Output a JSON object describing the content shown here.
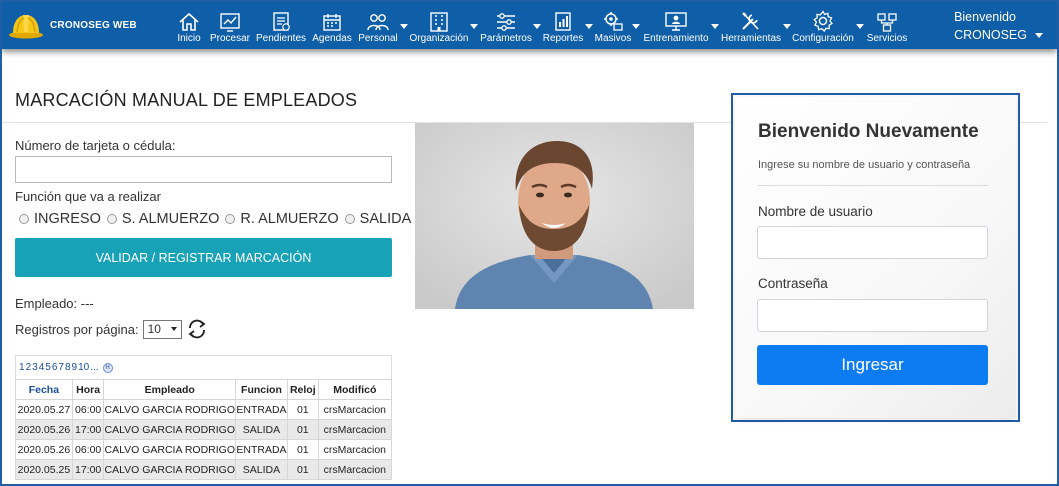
{
  "brand": {
    "name": "CRONOSEG WEB"
  },
  "nav": [
    {
      "label": "Inicio",
      "icon": "home-icon",
      "dropdown": false
    },
    {
      "label": "Procesar",
      "icon": "process-icon",
      "dropdown": false
    },
    {
      "label": "Pendientes",
      "icon": "pending-icon",
      "dropdown": false
    },
    {
      "label": "Agendas",
      "icon": "calendar-icon",
      "dropdown": false
    },
    {
      "label": "Personal",
      "icon": "people-icon",
      "dropdown": true
    },
    {
      "label": "Organización",
      "icon": "building-icon",
      "dropdown": true
    },
    {
      "label": "Parámetros",
      "icon": "sliders-icon",
      "dropdown": true
    },
    {
      "label": "Reportes",
      "icon": "report-icon",
      "dropdown": true
    },
    {
      "label": "Masivos",
      "icon": "bulk-icon",
      "dropdown": true
    },
    {
      "label": "Entrenamiento",
      "icon": "training-icon",
      "dropdown": true
    },
    {
      "label": "Herramientas",
      "icon": "tools-icon",
      "dropdown": true
    },
    {
      "label": "Configuración",
      "icon": "gear-icon",
      "dropdown": true
    },
    {
      "label": "Servicios",
      "icon": "services-icon",
      "dropdown": false
    }
  ],
  "user": {
    "greeting": "Bienvenido",
    "name": "CRONOSEG"
  },
  "page": {
    "title": "MARCACIÓN MANUAL DE EMPLEADOS"
  },
  "form": {
    "card_label": "Número de tarjeta o cédula:",
    "card_value": "",
    "function_label": "Función que va a realizar",
    "options": [
      "INGRESO",
      "S. ALMUERZO",
      "R. ALMUERZO",
      "SALIDA"
    ],
    "submit_label": "VALIDAR / REGISTRAR MARCACIÓN",
    "employee_label": "Empleado: ---",
    "per_page_label": "Registros por página:",
    "per_page_value": "10"
  },
  "pager": {
    "pages": [
      "1",
      "2",
      "3",
      "4",
      "5",
      "6",
      "7",
      "8",
      "9",
      "10",
      "..."
    ]
  },
  "table": {
    "columns": [
      "Fecha",
      "Hora",
      "Empleado",
      "Funcion",
      "Reloj",
      "Modificó"
    ],
    "rows": [
      [
        "2020.05.27",
        "06:00",
        "CALVO GARCIA RODRIGO",
        "ENTRADA",
        "01",
        "crsMarcacion"
      ],
      [
        "2020.05.26",
        "17:00",
        "CALVO GARCIA RODRIGO",
        "SALIDA",
        "01",
        "crsMarcacion"
      ],
      [
        "2020.05.26",
        "06:00",
        "CALVO GARCIA RODRIGO",
        "ENTRADA",
        "01",
        "crsMarcacion"
      ],
      [
        "2020.05.25",
        "17:00",
        "CALVO GARCIA RODRIGO",
        "SALIDA",
        "01",
        "crsMarcacion"
      ]
    ]
  },
  "login": {
    "title": "Bienvenido Nuevamente",
    "subtitle": "Ingrese su nombre de usuario y contraseña",
    "username_label": "Nombre de usuario",
    "username_value": "",
    "password_label": "Contraseña",
    "password_value": "",
    "submit_label": "Ingresar"
  },
  "colors": {
    "nav_bg": "#0f5ea8",
    "primary_teal": "#17a2b8",
    "login_button": "#0d7cf2"
  }
}
